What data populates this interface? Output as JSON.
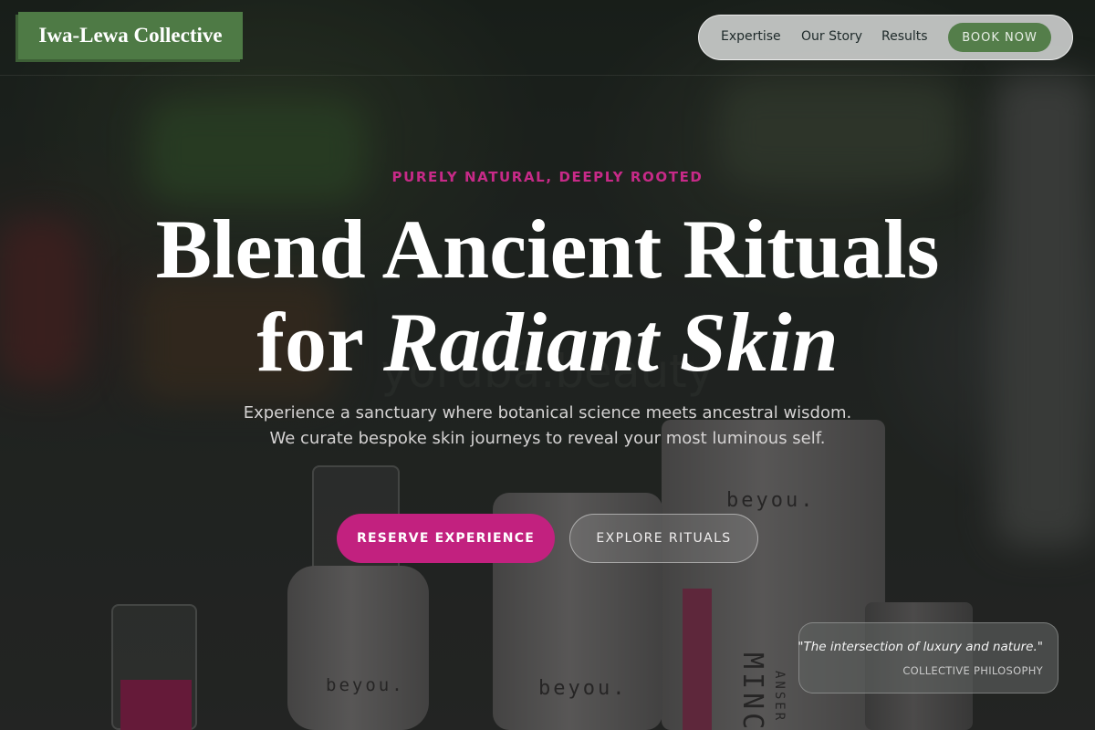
{
  "header": {
    "logo_text": "Iwa-Lewa Collective",
    "nav": {
      "items": [
        {
          "label": "Expertise"
        },
        {
          "label": "Our Story"
        },
        {
          "label": "Results"
        }
      ],
      "book_button": "BOOK NOW"
    }
  },
  "hero": {
    "eyebrow": "PURELY NATURAL, DEEPLY ROOTED",
    "headline_line1": "Blend Ancient Rituals",
    "headline_line2_plain": "for",
    "headline_line2_italic": "Radiant Skin",
    "subcopy": "Experience a sanctuary where botanical science meets ancestral wisdom. We curate bespoke skin journeys to reveal your most luminous self.",
    "cta_primary": "RESERVE EXPERIENCE",
    "cta_secondary": "EXPLORE RITUALS"
  },
  "background": {
    "watermark_text": "yoruba.beauty",
    "product_brand": "beyou.",
    "product_label_fragment": "MINC",
    "product_label_sub": "ANSER"
  },
  "quote_card": {
    "quote": "\"The intersection of luxury and nature.\"",
    "attribution": "COLLECTIVE PHILOSOPHY"
  },
  "colors": {
    "accent_pink": "#c2217f",
    "eyebrow_pink": "#c72a88",
    "brand_green": "#4e7a45",
    "book_green": "#547e4a"
  }
}
